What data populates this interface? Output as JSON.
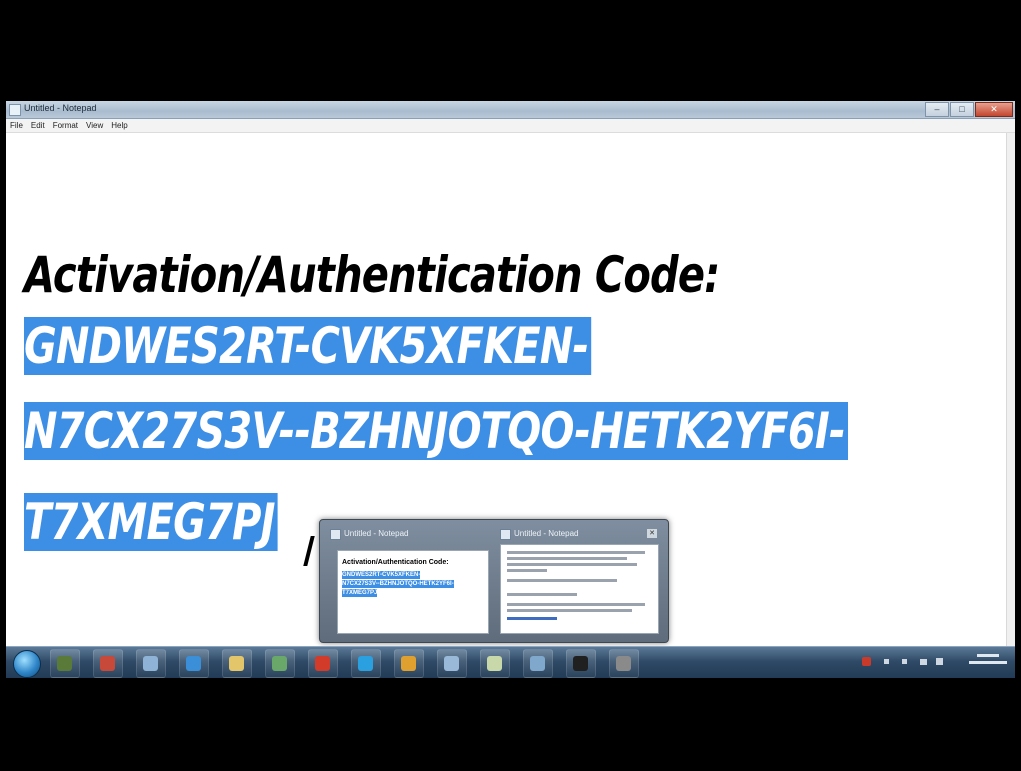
{
  "window": {
    "title": "Untitled - Notepad",
    "buttons": {
      "minimize": "–",
      "maximize": "□",
      "close": "✕"
    }
  },
  "menu": [
    "File",
    "Edit",
    "Format",
    "View",
    "Help"
  ],
  "document": {
    "heading": "Activation/Authentication Code:",
    "code_lines": [
      "GNDWES2RT-CVK5XFKEN-",
      "N7CX27S3V--BZHNJOTQO-HETK2YF6I-",
      "T7XMEG7PJ"
    ]
  },
  "peek": {
    "thumbnails": [
      {
        "title": "Untitled - Notepad",
        "heading": "Activation/Authentication Code:",
        "selected_lines": [
          "GNDWES2RT-CVK5XFKEN-",
          "N7CX27S3V--BZHNJOTQO-HETK2YF6I-",
          "T7XMEG7PJ"
        ]
      },
      {
        "title": "Untitled - Notepad",
        "close": "✕"
      }
    ]
  },
  "taskbar": {
    "apps": [
      {
        "icon": "minecraft-icon",
        "color": "#5a7a3a"
      },
      {
        "icon": "media-icon",
        "color": "#c7493a"
      },
      {
        "icon": "explorer-window-icon",
        "color": "#8fb3d6"
      },
      {
        "icon": "chrome-like-icon",
        "color": "#3a8fd8"
      },
      {
        "icon": "folder-icon",
        "color": "#e3c56a"
      },
      {
        "icon": "camera-icon",
        "color": "#6aa86a"
      },
      {
        "icon": "record-icon",
        "color": "#d23a2a"
      },
      {
        "icon": "skype-icon",
        "color": "#2aa0e0"
      },
      {
        "icon": "chrome-icon",
        "color": "#e0a030"
      },
      {
        "icon": "paint-icon",
        "color": "#9ab8d8"
      },
      {
        "icon": "notepad-icon",
        "color": "#c8d8a8"
      },
      {
        "icon": "network-icon",
        "color": "#7fa8cc"
      },
      {
        "icon": "terminal-icon",
        "color": "#202020"
      },
      {
        "icon": "steam-icon",
        "color": "#8a8a8a"
      }
    ],
    "tray_icons": [
      "flag-icon",
      "arrow-icon",
      "volume-icon",
      "signal-icon",
      "network-tray-icon"
    ]
  }
}
